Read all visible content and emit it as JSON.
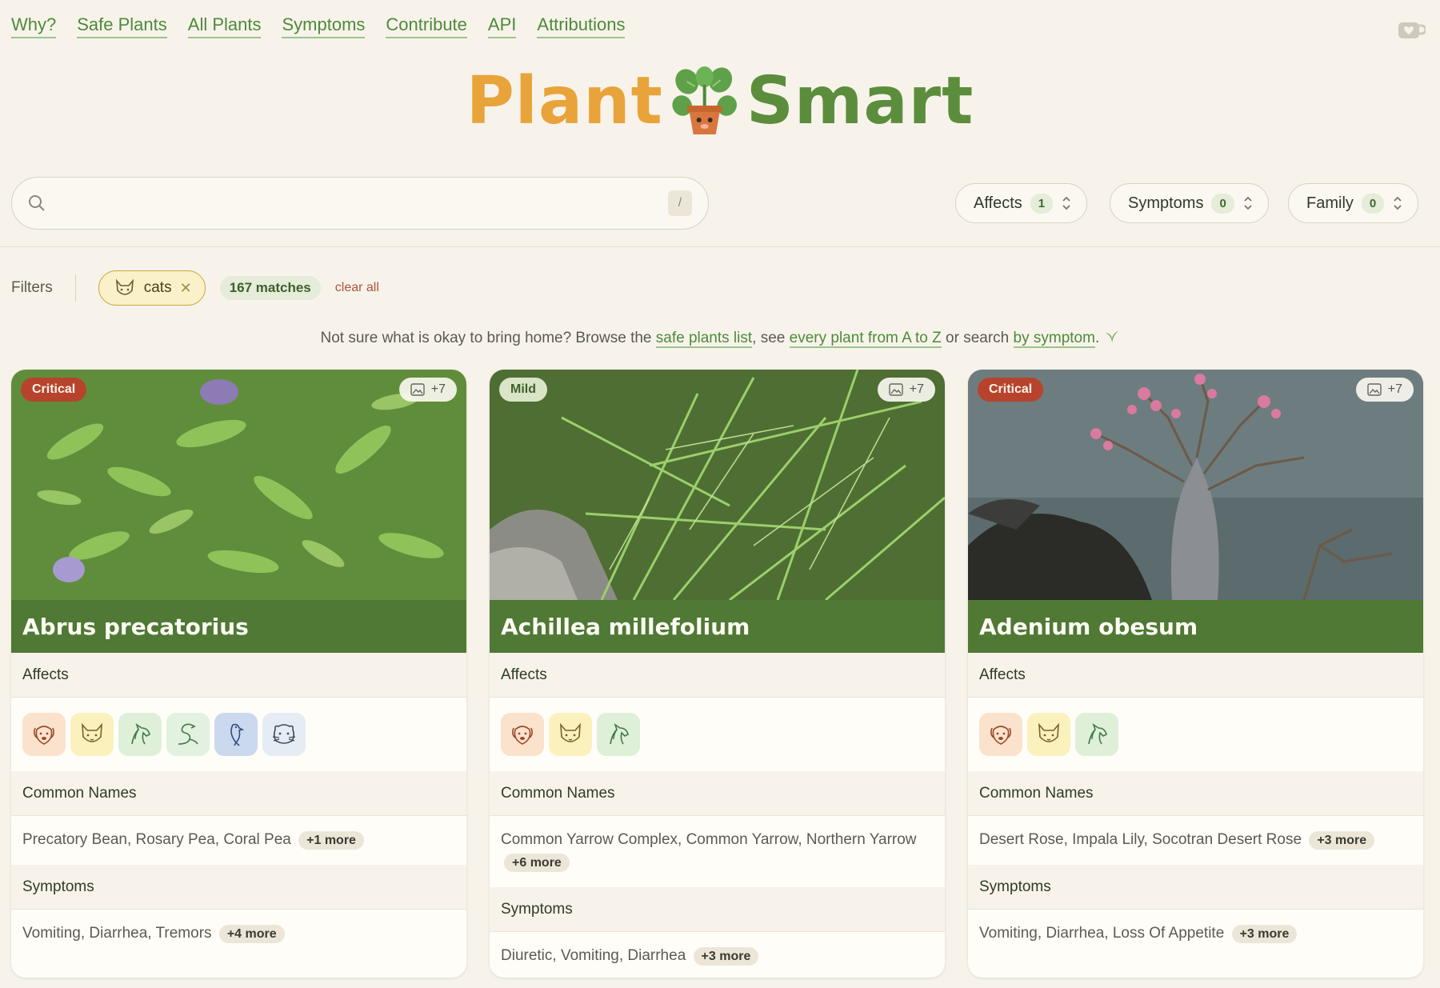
{
  "nav": {
    "items": [
      "Why?",
      "Safe Plants",
      "All Plants",
      "Symptoms",
      "Contribute",
      "API",
      "Attributions"
    ]
  },
  "logo": {
    "left": "Plant",
    "right": "Smart",
    "icon": "potted-plant-icon"
  },
  "search": {
    "value": "",
    "placeholder": "",
    "shortcut": "/"
  },
  "dropdowns": {
    "affects": {
      "label": "Affects",
      "count": "1"
    },
    "symptoms": {
      "label": "Symptoms",
      "count": "0"
    },
    "family": {
      "label": "Family",
      "count": "0"
    }
  },
  "filters": {
    "label": "Filters",
    "chip": "cats",
    "matches": "167 matches",
    "clear": "clear all"
  },
  "hint": {
    "p1": "Not sure what is okay to bring home? Browse the ",
    "link1": "safe plants list",
    "p2": ", see ",
    "link2": "every plant from A to Z",
    "p3": " or search ",
    "link3": "by symptom",
    "p4": ". "
  },
  "cards": [
    {
      "severity": "Critical",
      "photos": "+7",
      "name": "Abrus precatorius",
      "affects_label": "Affects",
      "affects": [
        "dog",
        "cat",
        "horse",
        "reptile",
        "bird",
        "small-mammal"
      ],
      "common_label": "Common Names",
      "common": "Precatory Bean, Rosary Pea, Coral Pea",
      "common_more": "+1 more",
      "symptoms_label": "Symptoms",
      "symptoms": "Vomiting, Diarrhea, Tremors",
      "symptoms_more": "+4 more"
    },
    {
      "severity": "Mild",
      "photos": "+7",
      "name": "Achillea millefolium",
      "affects_label": "Affects",
      "affects": [
        "dog",
        "cat",
        "horse"
      ],
      "common_label": "Common Names",
      "common": "Common Yarrow Complex, Common Yarrow, Northern Yarrow",
      "common_more": "+6 more",
      "symptoms_label": "Symptoms",
      "symptoms": "Diuretic, Vomiting, Diarrhea",
      "symptoms_more": "+3 more"
    },
    {
      "severity": "Critical",
      "photos": "+7",
      "name": "Adenium obesum",
      "affects_label": "Affects",
      "affects": [
        "dog",
        "cat",
        "horse"
      ],
      "common_label": "Common Names",
      "common": "Desert Rose, Impala Lily, Socotran Desert Rose",
      "common_more": "+3 more",
      "symptoms_label": "Symptoms",
      "symptoms": "Vomiting, Diarrhea, Loss Of Appetite",
      "symptoms_more": "+3 more"
    }
  ],
  "colors": {
    "accent": "#4e8a3a",
    "title_bar": "#4f7934",
    "critical": "#b8432c",
    "mild": "#d9e5c6",
    "logo_orange": "#e8a43a",
    "logo_green": "#5c8d3c"
  }
}
